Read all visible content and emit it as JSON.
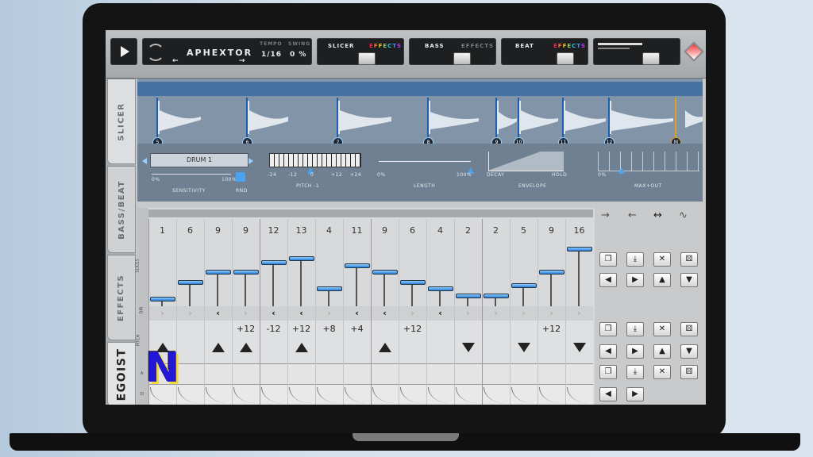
{
  "transport": {
    "play_icon": "play-icon"
  },
  "preset": {
    "name": "APHEXTOR",
    "prev": "←",
    "next": "→"
  },
  "tempo": {
    "label": "TEMPO",
    "value": "1/16"
  },
  "swing": {
    "label": "SWING",
    "value": "0 %"
  },
  "sections": [
    {
      "name": "SLICER",
      "fx": "EFFECTS"
    },
    {
      "name": "BASS",
      "fx": "EFFECTS"
    },
    {
      "name": "BEAT",
      "fx": "EFFECTS"
    }
  ],
  "tabs": {
    "slicer": "SLICER",
    "bassbeat": "BASS/BEAT",
    "effects": "EFFECTS",
    "brand": "EGOIST"
  },
  "slicer": {
    "markers": [
      "5",
      "6",
      "7",
      "8",
      "9",
      "10",
      "11",
      "12",
      "M"
    ],
    "kit": "DRUM 1",
    "sensitivity_label": "SENSITIVITY",
    "sensitivity_min": "0%",
    "sensitivity_max": "100%",
    "rnd_label": "RND",
    "pitch_label": "PITCH  -1",
    "pitch_ticks": [
      "-24",
      "-12",
      "0",
      "+12",
      "+24"
    ],
    "length_label": "LENGTH",
    "length_min": "0%",
    "length_max": "100%",
    "env_label": "ENVELOPE",
    "env_min": "DECAY",
    "env_max": "HOLD",
    "maxout_label": "MAX+OUT",
    "maxout_min": "0%"
  },
  "sequencer": {
    "slice_numbers": [
      "1",
      "6",
      "9",
      "9",
      "12",
      "13",
      "4",
      "11",
      "9",
      "6",
      "4",
      "2",
      "2",
      "5",
      "9",
      "16"
    ],
    "slice_level": [
      0.05,
      0.3,
      0.45,
      0.45,
      0.6,
      0.65,
      0.2,
      0.55,
      0.45,
      0.3,
      0.2,
      0.1,
      0.1,
      0.25,
      0.45,
      0.8
    ],
    "dir": [
      "›",
      "›",
      "‹",
      "›",
      "‹",
      "‹",
      "›",
      "‹",
      "‹",
      "›",
      "‹",
      "›",
      "›",
      "›",
      "›",
      "›"
    ],
    "pitch": [
      "",
      "",
      "",
      "+12",
      "-12",
      "+12",
      "+8",
      "+4",
      "",
      "+12",
      "",
      "",
      "",
      "",
      "+12",
      ""
    ],
    "tri": [
      "up",
      "",
      "up",
      "up",
      "",
      "up",
      "",
      "",
      "up",
      "",
      "",
      "dn",
      "",
      "dn",
      "",
      "dn"
    ],
    "row_labels": {
      "slices": "SLICES",
      "dir": "DIR",
      "pitch": "PITCH",
      "a": "A",
      "d": "D"
    }
  },
  "side_arrows": [
    "→",
    "←",
    "↔",
    "∿"
  ],
  "badge": "N"
}
